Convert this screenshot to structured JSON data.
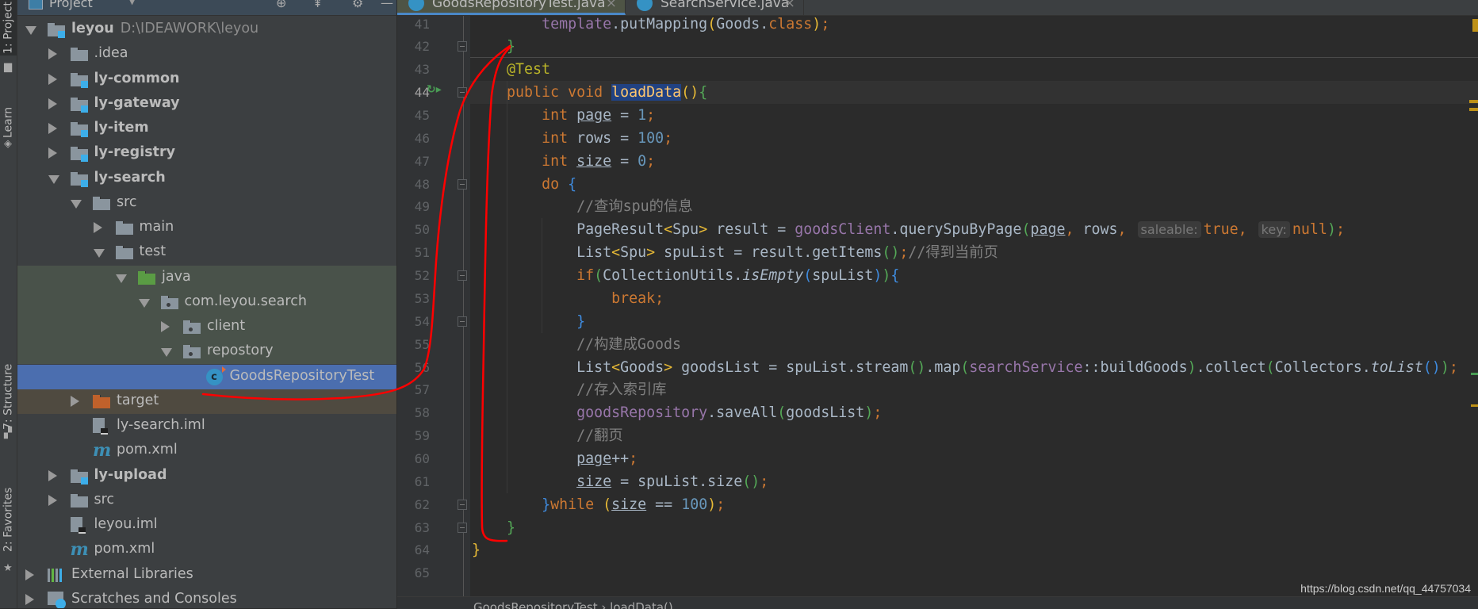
{
  "tool_strip": {
    "items": [
      {
        "label": "1: Project",
        "active": true
      },
      {
        "label": "Learn",
        "active": false
      },
      {
        "label": "7: Structure",
        "active": false
      },
      {
        "label": "2: Favorites",
        "active": false
      }
    ]
  },
  "project_panel": {
    "title": "Project",
    "tree": [
      {
        "label": "leyou",
        "path": "D:\\IDEAWORK\\leyou",
        "bold": true,
        "depth": 0,
        "state": "exp",
        "icon": "module"
      },
      {
        "label": ".idea",
        "depth": 1,
        "state": "col",
        "icon": "folder"
      },
      {
        "label": "ly-common",
        "bold": true,
        "depth": 1,
        "state": "col",
        "icon": "module"
      },
      {
        "label": "ly-gateway",
        "bold": true,
        "depth": 1,
        "state": "col",
        "icon": "module"
      },
      {
        "label": "ly-item",
        "bold": true,
        "depth": 1,
        "state": "col",
        "icon": "module"
      },
      {
        "label": "ly-registry",
        "bold": true,
        "depth": 1,
        "state": "col",
        "icon": "module"
      },
      {
        "label": "ly-search",
        "bold": true,
        "depth": 1,
        "state": "exp",
        "icon": "module"
      },
      {
        "label": "src",
        "depth": 2,
        "state": "exp",
        "icon": "folder"
      },
      {
        "label": "main",
        "depth": 3,
        "state": "col",
        "icon": "folder"
      },
      {
        "label": "test",
        "depth": 3,
        "state": "exp",
        "icon": "folder"
      },
      {
        "label": "java",
        "depth": 4,
        "state": "exp",
        "icon": "test-root",
        "bg": "test"
      },
      {
        "label": "com.leyou.search",
        "depth": 5,
        "state": "exp",
        "icon": "package",
        "bg": "test"
      },
      {
        "label": "client",
        "depth": 6,
        "state": "col",
        "icon": "package",
        "bg": "test"
      },
      {
        "label": "repostory",
        "depth": 6,
        "state": "exp",
        "icon": "package",
        "bg": "test"
      },
      {
        "label": "GoodsRepositoryTest",
        "depth": 7,
        "state": "none",
        "icon": "class",
        "bg": "sel"
      },
      {
        "label": "target",
        "depth": 2,
        "state": "col",
        "icon": "excluded",
        "bg": "excl"
      },
      {
        "label": "ly-search.iml",
        "depth": 2,
        "state": "none",
        "icon": "iml"
      },
      {
        "label": "pom.xml",
        "depth": 2,
        "state": "none",
        "icon": "maven"
      },
      {
        "label": "ly-upload",
        "bold": true,
        "depth": 1,
        "state": "col",
        "icon": "module"
      },
      {
        "label": "src",
        "depth": 1,
        "state": "col",
        "icon": "folder"
      },
      {
        "label": "leyou.iml",
        "depth": 1,
        "state": "none",
        "icon": "iml"
      },
      {
        "label": "pom.xml",
        "depth": 1,
        "state": "none",
        "icon": "maven"
      },
      {
        "label": "External Libraries",
        "depth": 0,
        "state": "col",
        "icon": "libraries"
      },
      {
        "label": "Scratches and Consoles",
        "depth": 0,
        "state": "col",
        "icon": "scratches"
      }
    ]
  },
  "editor": {
    "tabs": [
      {
        "label": "GoodsRepositoryTest.java",
        "active": true
      },
      {
        "label": "SearchService.java",
        "active": false
      }
    ],
    "current_line": 44,
    "lines": [
      {
        "num": 41,
        "tokens": [
          [
            "        ",
            ""
          ],
          [
            "template",
            "f"
          ],
          [
            ".putMapping",
            ""
          ],
          [
            "(",
            "by"
          ],
          [
            "Goods.",
            ""
          ],
          [
            "class",
            "k"
          ],
          [
            ")",
            "by"
          ],
          [
            ";",
            "k"
          ]
        ]
      },
      {
        "num": 42,
        "fold": true,
        "tokens": [
          [
            "    ",
            ""
          ],
          [
            "}",
            "bg"
          ]
        ]
      },
      {
        "num": 43,
        "tokens": [
          [
            "    ",
            ""
          ],
          [
            "@Test",
            "a"
          ]
        ]
      },
      {
        "num": 44,
        "fold": true,
        "run": true,
        "tokens": [
          [
            "    ",
            ""
          ],
          [
            "public void ",
            "k"
          ],
          [
            "loadData",
            "m sel"
          ],
          [
            "(",
            "by"
          ],
          [
            ")",
            "by"
          ],
          [
            "{",
            "bg"
          ]
        ]
      },
      {
        "num": 45,
        "tokens": [
          [
            "        ",
            ""
          ],
          [
            "int ",
            "k"
          ],
          [
            "page",
            "u"
          ],
          [
            " = ",
            ""
          ],
          [
            "1",
            "n"
          ],
          [
            ";",
            "k"
          ]
        ]
      },
      {
        "num": 46,
        "tokens": [
          [
            "        ",
            ""
          ],
          [
            "int ",
            "k"
          ],
          [
            "rows = ",
            ""
          ],
          [
            "100",
            "n"
          ],
          [
            ";",
            "k"
          ]
        ]
      },
      {
        "num": 47,
        "tokens": [
          [
            "        ",
            ""
          ],
          [
            "int ",
            "k"
          ],
          [
            "size",
            "u"
          ],
          [
            " = ",
            ""
          ],
          [
            "0",
            "n"
          ],
          [
            ";",
            "k"
          ]
        ]
      },
      {
        "num": 48,
        "fold": true,
        "tokens": [
          [
            "        ",
            ""
          ],
          [
            "do ",
            "k"
          ],
          [
            "{",
            "bb"
          ]
        ]
      },
      {
        "num": 49,
        "tokens": [
          [
            "            ",
            ""
          ],
          [
            "//查询spu的信息",
            "c"
          ]
        ]
      },
      {
        "num": 50,
        "tokens": [
          [
            "            ",
            ""
          ],
          [
            "PageResult",
            ""
          ],
          [
            "<",
            "by"
          ],
          [
            "Spu",
            ""
          ],
          [
            ">",
            "by"
          ],
          [
            " result = ",
            ""
          ],
          [
            "goodsClient",
            "f"
          ],
          [
            ".querySpuByPage",
            ""
          ],
          [
            "(",
            "bg"
          ],
          [
            "page",
            "u"
          ],
          [
            ", ",
            "k"
          ],
          [
            "rows",
            ""
          ],
          [
            ", ",
            "k"
          ],
          [
            "saleable:",
            "h"
          ],
          [
            "true",
            "k"
          ],
          [
            ", ",
            "k"
          ],
          [
            "key:",
            "h"
          ],
          [
            "null",
            "k"
          ],
          [
            ")",
            "bg"
          ],
          [
            ";",
            "k"
          ]
        ]
      },
      {
        "num": 51,
        "tokens": [
          [
            "            ",
            ""
          ],
          [
            "List",
            ""
          ],
          [
            "<",
            "by"
          ],
          [
            "Spu",
            ""
          ],
          [
            ">",
            "by"
          ],
          [
            " spuList = result.getItems",
            ""
          ],
          [
            "()",
            "bg"
          ],
          [
            ";",
            "k"
          ],
          [
            "//得到当前页",
            "c"
          ]
        ]
      },
      {
        "num": 52,
        "fold": true,
        "tokens": [
          [
            "            ",
            ""
          ],
          [
            "if",
            "k"
          ],
          [
            "(",
            "bg"
          ],
          [
            "CollectionUtils.",
            ""
          ],
          [
            "isEmpty",
            "i"
          ],
          [
            "(",
            "bb"
          ],
          [
            "spuList",
            ""
          ],
          [
            ")",
            "bb"
          ],
          [
            ")",
            "bg"
          ],
          [
            "{",
            "bb"
          ]
        ]
      },
      {
        "num": 53,
        "tokens": [
          [
            "                ",
            ""
          ],
          [
            "break;",
            "k"
          ]
        ]
      },
      {
        "num": 54,
        "fold": true,
        "tokens": [
          [
            "            ",
            ""
          ],
          [
            "}",
            "bb"
          ]
        ]
      },
      {
        "num": 55,
        "tokens": [
          [
            "            ",
            ""
          ],
          [
            "//构建成Goods",
            "c"
          ]
        ]
      },
      {
        "num": 56,
        "tokens": [
          [
            "            ",
            ""
          ],
          [
            "List",
            ""
          ],
          [
            "<",
            "by"
          ],
          [
            "Goods",
            ""
          ],
          [
            ">",
            "by"
          ],
          [
            " goodsList = spuList.stream",
            ""
          ],
          [
            "()",
            "bg"
          ],
          [
            ".map",
            ""
          ],
          [
            "(",
            "bg"
          ],
          [
            "searchService",
            "f"
          ],
          [
            "::buildGoods",
            ""
          ],
          [
            ")",
            "bg"
          ],
          [
            ".collect",
            ""
          ],
          [
            "(",
            "bg"
          ],
          [
            "Collectors.",
            ""
          ],
          [
            "toList",
            "i"
          ],
          [
            "()",
            "bb"
          ],
          [
            ")",
            "bg"
          ],
          [
            ";",
            "k"
          ]
        ]
      },
      {
        "num": 57,
        "tokens": [
          [
            "            ",
            ""
          ],
          [
            "//存入索引库",
            "c"
          ]
        ]
      },
      {
        "num": 58,
        "tokens": [
          [
            "            ",
            ""
          ],
          [
            "goodsRepository",
            "f"
          ],
          [
            ".saveAll",
            ""
          ],
          [
            "(",
            "bg"
          ],
          [
            "goodsList",
            ""
          ],
          [
            ")",
            "bg"
          ],
          [
            ";",
            "k"
          ]
        ]
      },
      {
        "num": 59,
        "tokens": [
          [
            "            ",
            ""
          ],
          [
            "//翻页",
            "c"
          ]
        ]
      },
      {
        "num": 60,
        "tokens": [
          [
            "            ",
            ""
          ],
          [
            "page",
            "u"
          ],
          [
            "++",
            ""
          ],
          [
            ";",
            "k"
          ]
        ]
      },
      {
        "num": 61,
        "tokens": [
          [
            "            ",
            ""
          ],
          [
            "size",
            "u"
          ],
          [
            " = spuList.size",
            ""
          ],
          [
            "()",
            "bg"
          ],
          [
            ";",
            "k"
          ]
        ]
      },
      {
        "num": 62,
        "fold": true,
        "tokens": [
          [
            "        ",
            ""
          ],
          [
            "}",
            "bb"
          ],
          [
            "while ",
            "k"
          ],
          [
            "(",
            "by"
          ],
          [
            "size",
            "u"
          ],
          [
            " == ",
            ""
          ],
          [
            "100",
            "n"
          ],
          [
            ")",
            "by"
          ],
          [
            ";",
            "k"
          ]
        ]
      },
      {
        "num": 63,
        "fold": true,
        "tokens": [
          [
            "    ",
            ""
          ],
          [
            "}",
            "bg"
          ]
        ]
      },
      {
        "num": 64,
        "tokens": [
          [
            "}",
            "by"
          ]
        ]
      },
      {
        "num": 65,
        "tokens": []
      }
    ]
  },
  "breadcrumb": "GoodsRepositoryTest  ›  loadData()",
  "watermark": "https://blog.csdn.net/qq_44757034",
  "colors": {
    "selection": "#4b6eaf",
    "annotation_pen": "#ff0000",
    "keyword": "#cc7832",
    "warning_marker": "#be9117"
  }
}
